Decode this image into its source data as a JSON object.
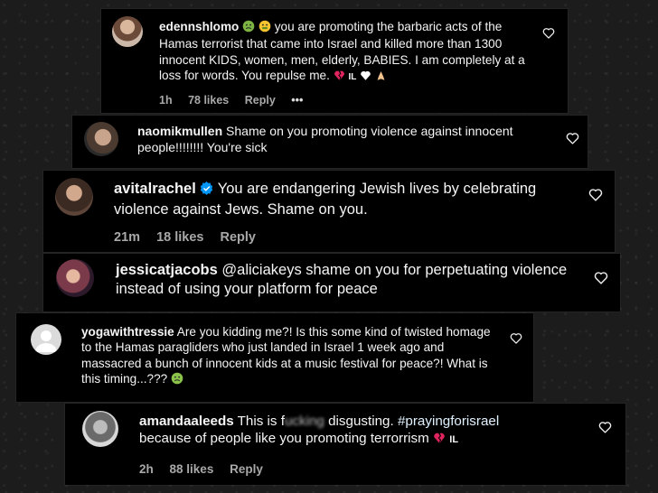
{
  "comments": [
    {
      "username": "edennshlomo",
      "text": "you are promoting the barbaric acts of the Hamas terrorist that came into Israel and killed more than 1300 innocent KIDS, women, men, elderly, BABIES. I am completely at a loss for words. You repulse me.",
      "flag": "IL",
      "time": "1h",
      "likes": "78 likes",
      "reply": "Reply",
      "more": "•••"
    },
    {
      "username": "naomikmullen",
      "text": "Shame on you promoting violence against innocent people!!!!!!!! You're sick"
    },
    {
      "username": "avitalrachel",
      "text": "You are endangering Jewish lives by celebrating violence against Jews. Shame on you.",
      "time": "21m",
      "likes": "18 likes",
      "reply": "Reply"
    },
    {
      "username": "jessicatjacobs",
      "mention": "@aliciakeys",
      "text": "shame on you for perpetuating violence instead of using your platform for peace"
    },
    {
      "username": "yogawithtressie",
      "text": "Are you kidding me?! Is this some kind of twisted homage to the Hamas paragliders who just landed in Israel 1 week ago and massacred a bunch of innocent kids at a music festival for peace?! What is this timing...???"
    },
    {
      "username": "amandaaleeds",
      "text_before": "This is f",
      "text_blurred": "ucking",
      "text_after": "disgusting.",
      "hashtag": "#prayingforisrael",
      "text_line2": "because of people like you promoting terrorrism",
      "flag": "IL",
      "time": "2h",
      "likes": "88 likes",
      "reply": "Reply"
    }
  ],
  "icons": {
    "heart": "heart-outline-icon",
    "verified": "verified-badge-icon",
    "nauseated": "nauseated-face-emoji",
    "broken_heart": "broken-heart-emoji",
    "white_heart": "white-heart-emoji",
    "praying": "folded-hands-emoji"
  },
  "colors": {
    "card_bg": "#000000",
    "text": "#f5f5f5",
    "meta": "#a8a8a8",
    "verified": "#0095f6",
    "hashtag": "#e0f1ff",
    "broken_heart": "#e0245e"
  }
}
